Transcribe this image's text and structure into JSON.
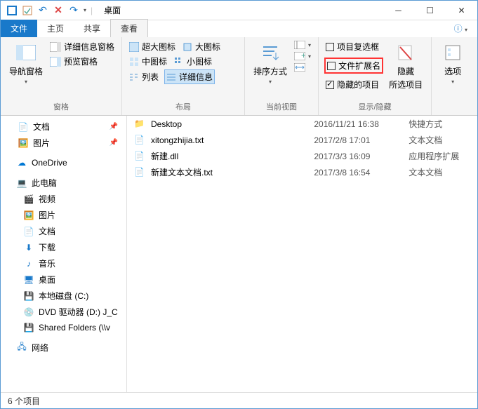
{
  "titlebar": {
    "title": "桌面"
  },
  "tabs": {
    "file": "文件",
    "home": "主页",
    "share": "共享",
    "view": "查看"
  },
  "ribbon": {
    "panes": {
      "nav_pane": "导航窗格",
      "preview_pane": "预览窗格",
      "details_pane": "详细信息窗格",
      "label": "窗格"
    },
    "layout": {
      "extra_large": "超大图标",
      "large": "大图标",
      "medium": "中图标",
      "small": "小图标",
      "list": "列表",
      "details": "详细信息",
      "label": "布局"
    },
    "current_view": {
      "sort": "排序方式",
      "label": "当前视图"
    },
    "show_hide": {
      "item_checkboxes": "项目复选框",
      "file_ext": "文件扩展名",
      "hidden_items": "隐藏的项目",
      "hide_selected": "隐藏",
      "hide_selected2": "所选项目",
      "label": "显示/隐藏"
    },
    "options": {
      "options": "选项"
    }
  },
  "sidebar": {
    "quick": {
      "docs": "文档",
      "pictures": "图片"
    },
    "onedrive": "OneDrive",
    "thispc": "此电脑",
    "pc_items": {
      "videos": "视频",
      "pictures": "图片",
      "documents": "文档",
      "downloads": "下载",
      "music": "音乐",
      "desktop": "桌面",
      "localdisk": "本地磁盘 (C:)",
      "dvd": "DVD 驱动器 (D:) J_C",
      "shared": "Shared Folders (\\\\v"
    },
    "network": "网络"
  },
  "files": [
    {
      "name": "Desktop",
      "date": "2016/11/21 16:38",
      "type": "快捷方式",
      "icon": "folder"
    },
    {
      "name": "xitongzhijia.txt",
      "date": "2017/2/8 17:01",
      "type": "文本文档",
      "icon": "text"
    },
    {
      "name": "新建.dll",
      "date": "2017/3/3 16:09",
      "type": "应用程序扩展",
      "icon": "dll"
    },
    {
      "name": "新建文本文档.txt",
      "date": "2017/3/8 16:54",
      "type": "文本文档",
      "icon": "text"
    }
  ],
  "status": {
    "count": "6 个项目"
  }
}
